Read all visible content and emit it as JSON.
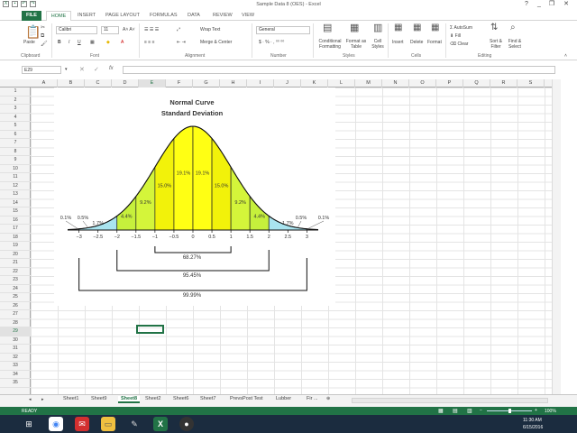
{
  "window": {
    "title": "Sample Data 8 (OES) - Excel",
    "minimize": "_",
    "restore": "❐",
    "close": "✕",
    "help": "?"
  },
  "ribbon_tabs": [
    "FILE",
    "HOME",
    "INSERT",
    "PAGE LAYOUT",
    "FORMULAS",
    "DATA",
    "REVIEW",
    "VIEW"
  ],
  "ribbon": {
    "paste": "Paste",
    "font_name": "Calibri",
    "font_size": "11",
    "wrap_text": "Wrap Text",
    "merge_center": "Merge & Center",
    "number_format": "General",
    "conditional_formatting": "Conditional Formatting",
    "format_as_table": "Format as Table",
    "cell_styles": "Cell Styles",
    "insert": "Insert",
    "delete": "Delete",
    "format": "Format",
    "autosum": "AutoSum",
    "fill": "Fill",
    "clear": "Clear",
    "sort_filter": "Sort & Filter",
    "find_select": "Find & Select",
    "groups": [
      "Clipboard",
      "Font",
      "Alignment",
      "Number",
      "Styles",
      "Cells",
      "Editing"
    ]
  },
  "formula_bar": {
    "name_box": "E29",
    "fx": "fx",
    "value": ""
  },
  "columns": [
    "A",
    "B",
    "C",
    "D",
    "E",
    "F",
    "G",
    "H",
    "I",
    "J",
    "K",
    "L",
    "M",
    "N",
    "O",
    "P",
    "Q",
    "R",
    "S"
  ],
  "rows": [
    "1",
    "2",
    "3",
    "4",
    "5",
    "6",
    "7",
    "8",
    "9",
    "10",
    "11",
    "12",
    "13",
    "14",
    "15",
    "16",
    "17",
    "18",
    "19",
    "20",
    "21",
    "22",
    "23",
    "24",
    "25",
    "26",
    "27",
    "28",
    "29",
    "30",
    "31",
    "32",
    "33",
    "34",
    "35"
  ],
  "chart_data": {
    "type": "area",
    "title": "Normal Curve",
    "subtitle": "Standard Deviation",
    "x_ticks": [
      "-3",
      "-2.5",
      "-2",
      "-1.5",
      "-1",
      "-0.5",
      "0",
      "0.5",
      "1",
      "1.5",
      "2",
      "2.5",
      "3"
    ],
    "xlim": [
      -3.3,
      3.3
    ],
    "bands": [
      {
        "from": -3,
        "to": -2,
        "label": "1.7%",
        "color": "#a9e4ef"
      },
      {
        "from": -2,
        "to": -1.5,
        "label": "4.4%",
        "color": "#c6f03c"
      },
      {
        "from": -1.5,
        "to": -1,
        "label": "9.2%",
        "color": "#d4f53a"
      },
      {
        "from": -1,
        "to": -0.5,
        "label": "15.0%",
        "color": "#f2f20a"
      },
      {
        "from": -0.5,
        "to": 0,
        "label": "19.1%",
        "color": "#ffff14"
      },
      {
        "from": 0,
        "to": 0.5,
        "label": "19.1%",
        "color": "#ffff14"
      },
      {
        "from": 0.5,
        "to": 1,
        "label": "15.0%",
        "color": "#f2f20a"
      },
      {
        "from": 1,
        "to": 1.5,
        "label": "9.2%",
        "color": "#d4f53a"
      },
      {
        "from": 1.5,
        "to": 2,
        "label": "4.4%",
        "color": "#c6f03c"
      },
      {
        "from": 2,
        "to": 3,
        "label": "1.7%",
        "color": "#a9e4ef"
      }
    ],
    "tail_labels": [
      "0.1%",
      "0.5%",
      "0.5%",
      "0.1%"
    ],
    "ranges": [
      {
        "sd": 1,
        "label": "68.27%"
      },
      {
        "sd": 2,
        "label": "95.45%"
      },
      {
        "sd": 3,
        "label": "99.99%"
      }
    ]
  },
  "sheets": [
    "Sheet1",
    "Sheet9",
    "Sheet8",
    "Sheet2",
    "Sheet6",
    "Sheet7",
    "PrevsPost Test",
    "Lubber",
    "Fir ..."
  ],
  "active_sheet": "Sheet8",
  "status": {
    "mode": "READY",
    "zoom": "100%"
  },
  "taskbar": {
    "time": "11:30 AM",
    "date": "6/15/2016"
  },
  "colors": {
    "excel_green": "#217346",
    "taskbar": "#1b2c3f"
  }
}
